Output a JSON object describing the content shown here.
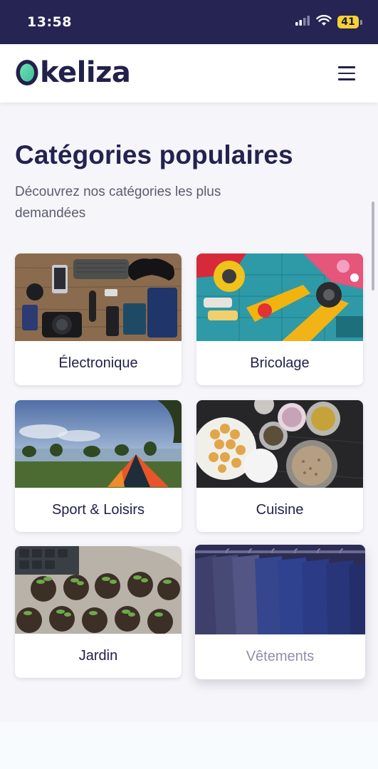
{
  "status_bar": {
    "time": "13:58",
    "battery": "41"
  },
  "header": {
    "logo_text": "keliza",
    "brand_color": "#22214a",
    "logo_accent": "#5ad3a8",
    "menu_icon": "hamburger-menu-icon"
  },
  "main": {
    "title": "Catégories populaires",
    "subtitle": "Découvrez nos catégories les plus demandées"
  },
  "categories": [
    {
      "label": "Électronique",
      "image": "electronics-flatlay"
    },
    {
      "label": "Bricolage",
      "image": "sewing-tools"
    },
    {
      "label": "Sport & Loisirs",
      "image": "camping-tent-lake"
    },
    {
      "label": "Cuisine",
      "image": "kitchen-ingredients"
    },
    {
      "label": "Jardin",
      "image": "seedlings-pots"
    },
    {
      "label": "Vêtements",
      "image": "clothing-rack-suits"
    }
  ]
}
